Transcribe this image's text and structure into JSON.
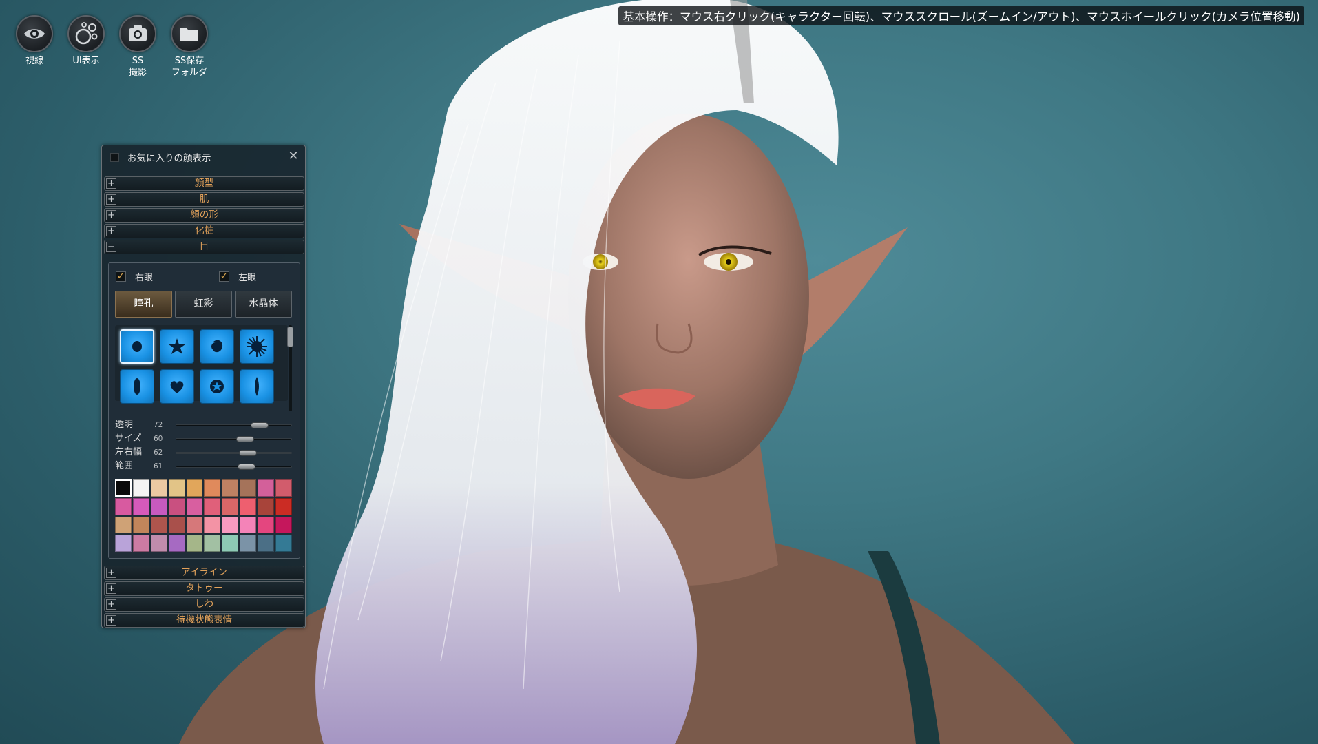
{
  "hint_bar": "基本操作：マウス右クリック(キャラクター回転)、マウススクロール(ズームイン/アウト)、マウスホイールクリック(カメラ位置移動)",
  "toolbar": [
    {
      "label": "視線",
      "icon": "eye-icon"
    },
    {
      "label": "UI表示",
      "icon": "bubbles-icon"
    },
    {
      "label": "SS\n撮影",
      "icon": "camera-icon"
    },
    {
      "label": "SS保存\nフォルダ",
      "icon": "folder-icon"
    }
  ],
  "panel": {
    "title": "お気に入りの顔表示",
    "favorite_checked": false,
    "sections_top": [
      {
        "label": "顔型",
        "expanded": false
      },
      {
        "label": "肌",
        "expanded": false
      },
      {
        "label": "顔の形",
        "expanded": false
      },
      {
        "label": "化粧",
        "expanded": false
      },
      {
        "label": "目",
        "expanded": true
      }
    ],
    "eye": {
      "right_eye": {
        "label": "右眼",
        "checked": true
      },
      "left_eye": {
        "label": "左眼",
        "checked": true
      },
      "tabs": [
        {
          "label": "瞳孔",
          "active": true
        },
        {
          "label": "虹彩",
          "active": false
        },
        {
          "label": "水晶体",
          "active": false
        }
      ],
      "pupil_shapes": [
        {
          "icon": "round-pupil-icon",
          "selected": true
        },
        {
          "icon": "star-pupil-icon",
          "selected": false
        },
        {
          "icon": "crescent-pupil-icon",
          "selected": false
        },
        {
          "icon": "burst-pupil-icon",
          "selected": false
        },
        {
          "icon": "oval-pupil-icon",
          "selected": false
        },
        {
          "icon": "heart-pupil-icon",
          "selected": false
        },
        {
          "icon": "ring-star-pupil-icon",
          "selected": false
        },
        {
          "icon": "slit-pupil-icon",
          "selected": false
        }
      ],
      "sliders": [
        {
          "label": "透明",
          "value": "72",
          "level": 0.72
        },
        {
          "label": "サイズ",
          "value": "60",
          "level": 0.6
        },
        {
          "label": "左右幅",
          "value": "62",
          "level": 0.62
        },
        {
          "label": "範囲",
          "value": "61",
          "level": 0.61
        }
      ],
      "palette": [
        "#0a0a0a",
        "#f4f4f4",
        "#ecc9a2",
        "#e2c487",
        "#e1a65b",
        "#e08a5c",
        "#bf8163",
        "#a5735a",
        "#d3609a",
        "#d25c6c",
        "#d85aa0",
        "#d65aba",
        "#c75abf",
        "#c95080",
        "#d85fa0",
        "#e0607a",
        "#d96768",
        "#ee5f6f",
        "#a8443a",
        "#cb2c24",
        "#cfa276",
        "#c1855b",
        "#ae554d",
        "#a9504b",
        "#d6787a",
        "#f393a5",
        "#f79ac0",
        "#f483b8",
        "#e4467f",
        "#c5175c",
        "#b9a3d9",
        "#cc7ba3",
        "#c08cac",
        "#a66ac2",
        "#a5b689",
        "#a2c0a3",
        "#8ecab5",
        "#7b93a7",
        "#4b6f86",
        "#347a95"
      ],
      "palette_selected": 0
    },
    "sections_bottom": [
      {
        "label": "アイライン",
        "expanded": false
      },
      {
        "label": "タトゥー",
        "expanded": false
      },
      {
        "label": "しわ",
        "expanded": false
      },
      {
        "label": "待機状態表情",
        "expanded": false
      }
    ]
  }
}
